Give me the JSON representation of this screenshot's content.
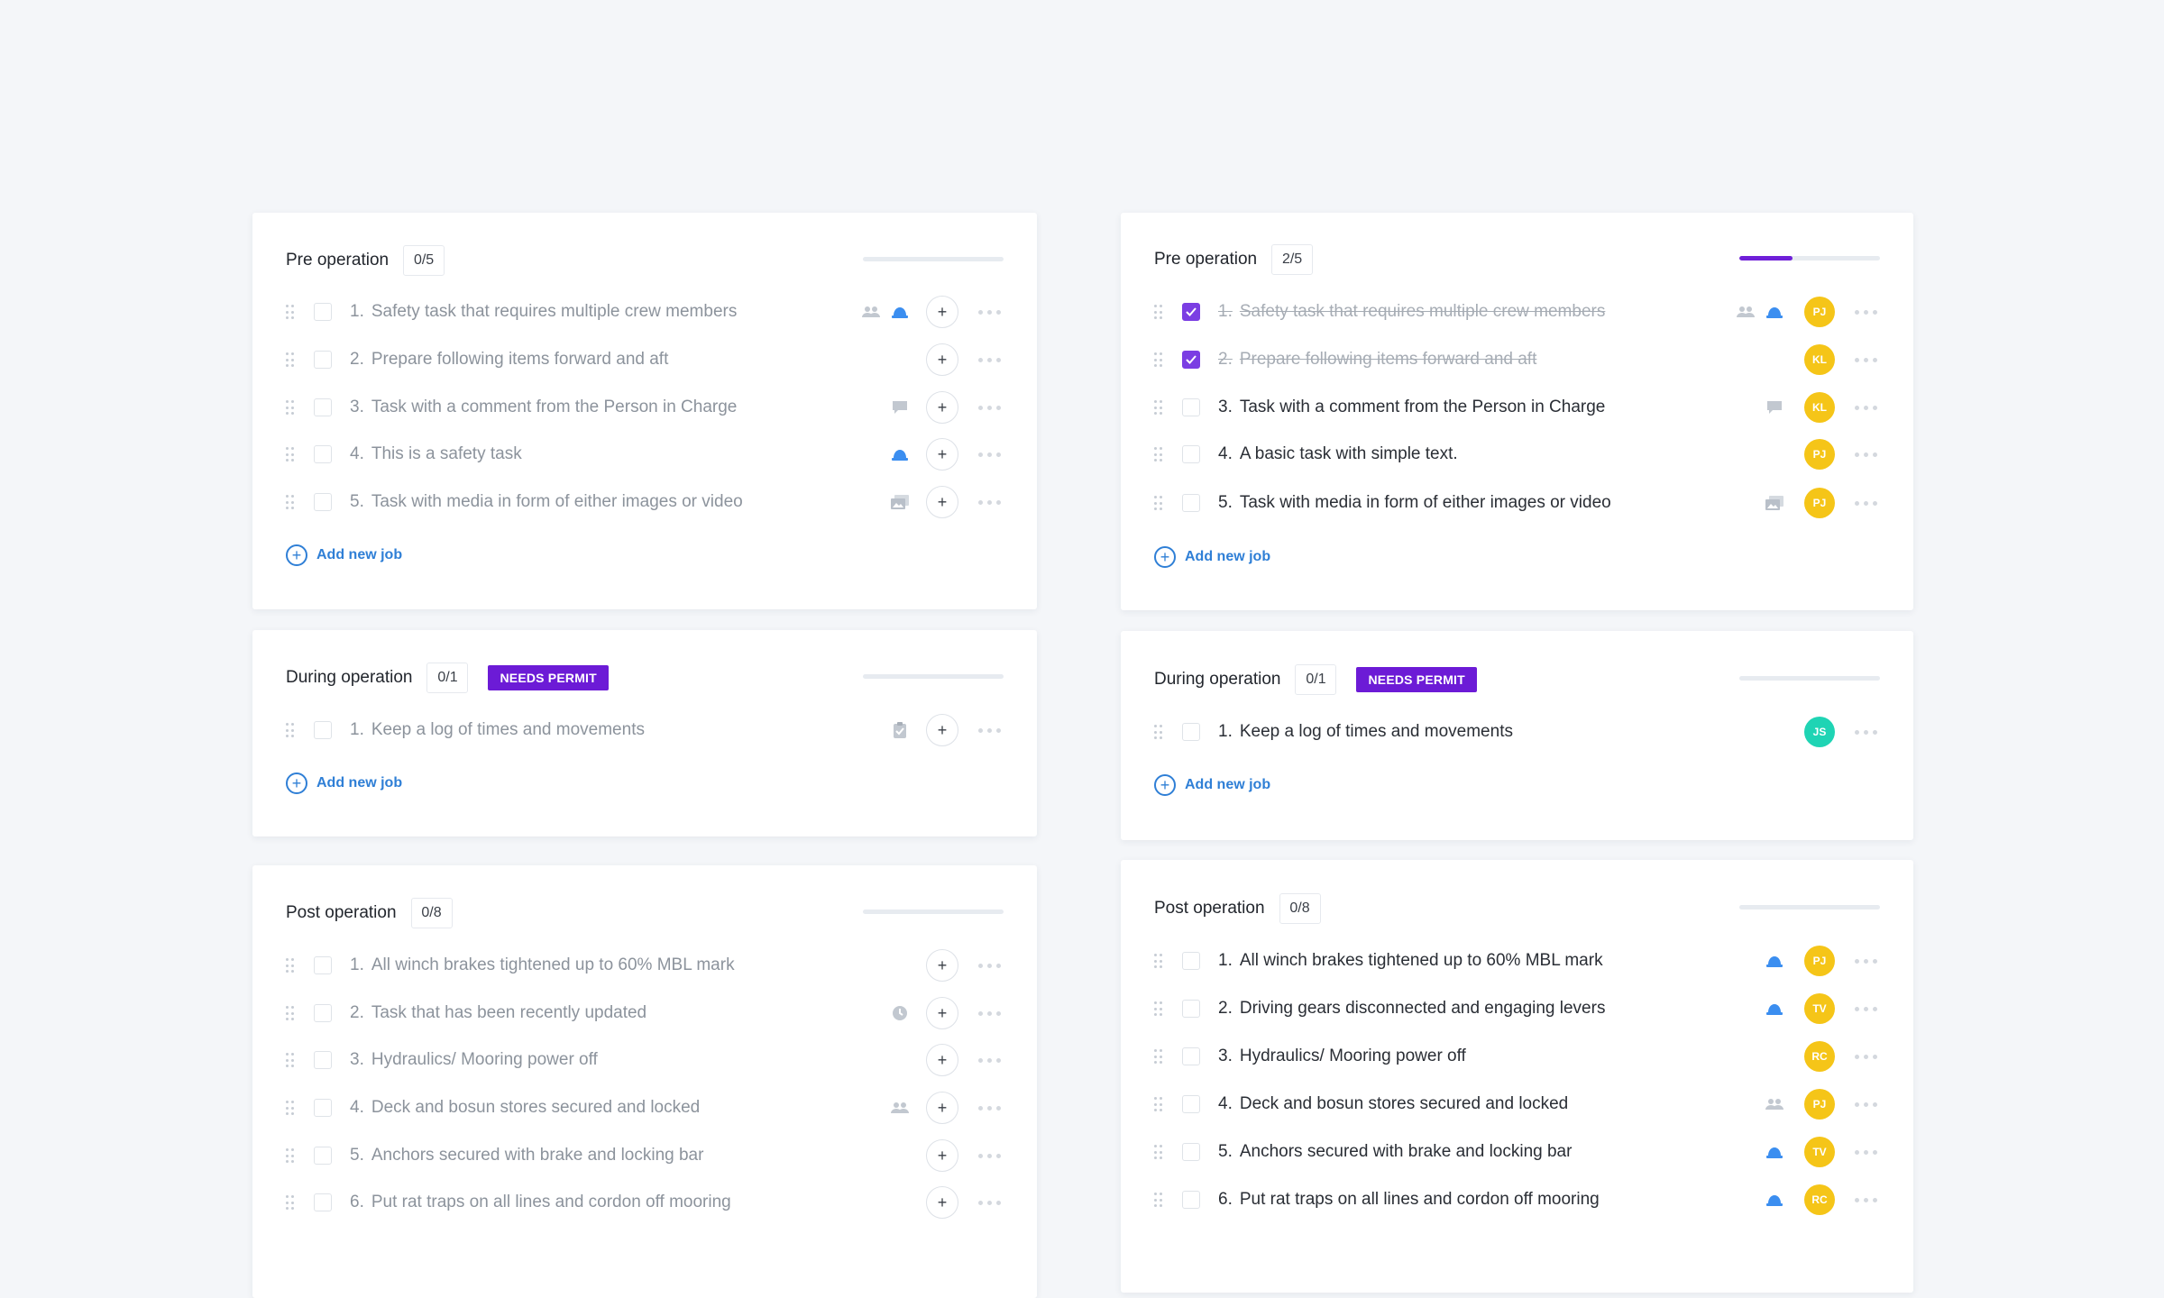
{
  "left": {
    "sections": [
      {
        "title": "Pre operation",
        "count": "0/5",
        "progress": 0,
        "add_label": "Add new job",
        "tasks": [
          {
            "num": "1.",
            "text": "Safety task that requires multiple crew members",
            "icons": [
              "crew-icon",
              "helmet-icon"
            ]
          },
          {
            "num": "2.",
            "text": "Prepare following items forward and aft",
            "icons": []
          },
          {
            "num": "3.",
            "text": "Task with a comment from the Person in Charge",
            "icons": [
              "comment-icon"
            ]
          },
          {
            "num": "4.",
            "text": "This is a safety task",
            "icons": [
              "helmet-icon"
            ]
          },
          {
            "num": "5.",
            "text": "Task with media in form of either images or video",
            "icons": [
              "media-icon"
            ]
          }
        ]
      },
      {
        "title": "During operation",
        "count": "0/1",
        "badge": "NEEDS PERMIT",
        "progress": 0,
        "add_label": "Add new job",
        "tasks": [
          {
            "num": "1.",
            "text": "Keep a log of times and movements",
            "icons": [
              "clipboard-icon"
            ]
          }
        ]
      },
      {
        "title": "Post operation",
        "count": "0/8",
        "progress": 0,
        "tasks": [
          {
            "num": "1.",
            "text": "All winch brakes tightened up to 60% MBL mark",
            "icons": []
          },
          {
            "num": "2.",
            "text": "Task that has been recently updated",
            "icons": [
              "clock-icon"
            ]
          },
          {
            "num": "3.",
            "text": "Hydraulics/ Mooring power off",
            "icons": []
          },
          {
            "num": "4.",
            "text": "Deck and bosun stores secured and locked",
            "icons": [
              "crew-icon"
            ]
          },
          {
            "num": "5.",
            "text": "Anchors secured with brake and locking bar",
            "icons": []
          },
          {
            "num": "6.",
            "text": "Put rat traps on all lines and cordon off mooring",
            "icons": []
          }
        ]
      }
    ]
  },
  "right": {
    "sections": [
      {
        "title": "Pre operation",
        "count": "2/5",
        "progress": 0.38,
        "add_label": "Add new job",
        "tasks": [
          {
            "num": "1.",
            "text": "Safety task that requires multiple crew members",
            "done": true,
            "icons": [
              "crew-icon",
              "helmet-icon"
            ],
            "avatar": "PJ",
            "avatar_color": "#f5c518"
          },
          {
            "num": "2.",
            "text": "Prepare following items forward and aft",
            "done": true,
            "icons": [],
            "avatar": "KL",
            "avatar_color": "#f5c518"
          },
          {
            "num": "3.",
            "text": "Task with a comment from the Person in Charge",
            "icons": [
              "comment-icon"
            ],
            "avatar": "KL",
            "avatar_color": "#f5c518"
          },
          {
            "num": "4.",
            "text": "A basic task with simple text.",
            "icons": [],
            "avatar": "PJ",
            "avatar_color": "#f5c518"
          },
          {
            "num": "5.",
            "text": "Task with media in form of either images or video",
            "icons": [
              "media-icon"
            ],
            "avatar": "PJ",
            "avatar_color": "#f5c518"
          }
        ]
      },
      {
        "title": "During operation",
        "count": "0/1",
        "badge": "NEEDS PERMIT",
        "progress": 0,
        "add_label": "Add new job",
        "tasks": [
          {
            "num": "1.",
            "text": "Keep a log of times and movements",
            "icons": [],
            "avatar": "JS",
            "avatar_color": "#1fd4b4"
          }
        ]
      },
      {
        "title": "Post operation",
        "count": "0/8",
        "progress": 0,
        "tasks": [
          {
            "num": "1.",
            "text": "All winch brakes tightened up to 60% MBL mark",
            "icons": [
              "helmet-icon"
            ],
            "avatar": "PJ",
            "avatar_color": "#f5c518"
          },
          {
            "num": "2.",
            "text": "Driving gears disconnected and engaging levers",
            "icons": [
              "helmet-icon"
            ],
            "avatar": "TV",
            "avatar_color": "#f5c518"
          },
          {
            "num": "3.",
            "text": "Hydraulics/ Mooring power off",
            "icons": [],
            "avatar": "RC",
            "avatar_color": "#f5c518"
          },
          {
            "num": "4.",
            "text": "Deck and bosun stores secured and locked",
            "icons": [
              "crew-icon"
            ],
            "avatar": "PJ",
            "avatar_color": "#f5c518"
          },
          {
            "num": "5.",
            "text": "Anchors secured with brake and locking bar",
            "icons": [
              "helmet-icon"
            ],
            "avatar": "TV",
            "avatar_color": "#f5c518"
          },
          {
            "num": "6.",
            "text": "Put rat traps on all lines and cordon off mooring",
            "icons": [
              "helmet-icon"
            ],
            "avatar": "RC",
            "avatar_color": "#f5c518"
          }
        ]
      }
    ]
  },
  "colors": {
    "accent_purple": "#6c1bd6",
    "link_blue": "#2f7fd6",
    "helmet_blue": "#3b8ef0",
    "avatar_yellow": "#f5c518",
    "avatar_teal": "#1fd4b4"
  }
}
